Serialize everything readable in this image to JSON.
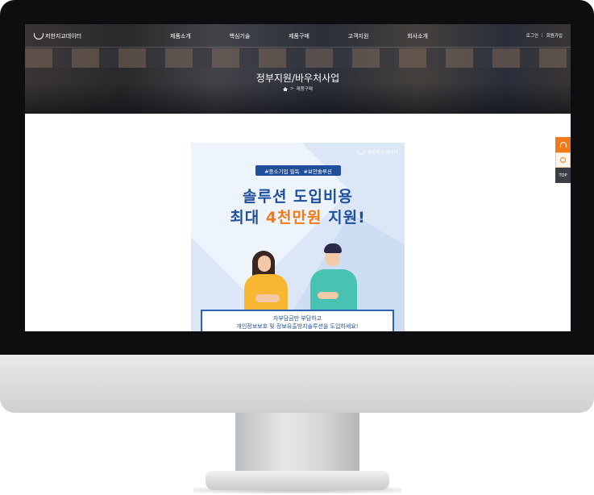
{
  "header": {
    "logo_text": "저한지교데이터",
    "nav": [
      "제품소개",
      "핵심기술",
      "제품구매",
      "고객지원",
      "회사소개"
    ],
    "util": {
      "login": "로그인",
      "separator": "|",
      "signup": "회원가입"
    }
  },
  "hero": {
    "title": "정부지원/바우처사업",
    "breadcrumb": {
      "separator": ">",
      "current": "제품구매"
    }
  },
  "side": {
    "top_label": "TOP"
  },
  "banner": {
    "logo_text": "저한지교데이터",
    "tags": [
      "#중소기업 필독",
      "#보안솔루션"
    ],
    "headline1": "솔루션 도입비용",
    "headline2_pre": "최대 ",
    "headline2_highlight": "4천만원",
    "headline2_post": " 지원!",
    "caption_line1": "자부담금만 부담하고",
    "caption_line2": "개인정보보호 및 정보유출방지솔루션을 도입하세요!"
  },
  "colors": {
    "accent": "#f07a1a",
    "brand_blue": "#1f4f9a",
    "side_dark": "#3b3e46"
  }
}
